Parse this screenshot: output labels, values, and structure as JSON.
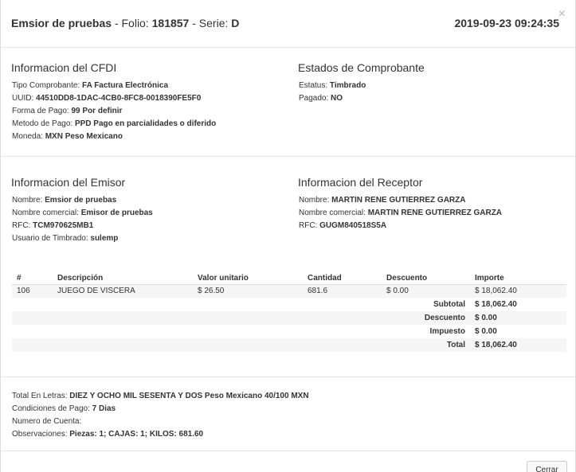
{
  "header": {
    "emisor": "Emsior de pruebas",
    "folio_label": "Folio:",
    "folio": "181857",
    "serie_label": "Serie:",
    "serie": "D",
    "datetime": "2019-09-23 09:24:35",
    "close_glyph": "×"
  },
  "cfdi": {
    "title": "Informacion del CFDI",
    "fields": [
      {
        "label": "Tipo Comprobante:",
        "value": "FA Factura Electrónica"
      },
      {
        "label": "UUID:",
        "value": "44510DD8-1DAC-4CB0-8FC8-0018390FE5F0"
      },
      {
        "label": "Forma de Pago:",
        "value": "99 Por definir"
      },
      {
        "label": "Metodo de Pago:",
        "value": "PPD Pago en parcialidades o diferido"
      },
      {
        "label": "Moneda:",
        "value": "MXN Peso Mexicano"
      }
    ]
  },
  "estados": {
    "title": "Estados de Comprobante",
    "fields": [
      {
        "label": "Estatus:",
        "value": "Timbrado"
      },
      {
        "label": "Pagado:",
        "value": "NO"
      }
    ]
  },
  "emisor": {
    "title": "Informacion del Emisor",
    "fields": [
      {
        "label": "Nombre:",
        "value": "Emsior de pruebas"
      },
      {
        "label": "Nombre comercial:",
        "value": "Emisor de pruebas"
      },
      {
        "label": "RFC:",
        "value": "TCM970625MB1"
      },
      {
        "label": "Usuario de Timbrado:",
        "value": "sulemp"
      }
    ]
  },
  "receptor": {
    "title": "Informacion del Receptor",
    "fields": [
      {
        "label": "Nombre:",
        "value": "MARTIN RENE GUTIERREZ GARZA"
      },
      {
        "label": "Nombre comercial:",
        "value": "MARTIN RENE GUTIERREZ GARZA"
      },
      {
        "label": "RFC:",
        "value": "GUGM840518S5A"
      }
    ]
  },
  "items": {
    "headers": [
      "#",
      "Descripción",
      "Valor unitario",
      "Cantidad",
      "Descuento",
      "Importe"
    ],
    "rows": [
      [
        "106",
        "JUEGO DE VISCERA",
        "$ 26.50",
        "681.6",
        "$ 0.00",
        "$ 18,062.40"
      ]
    ],
    "totals": [
      {
        "label": "Subtotal",
        "value": "$ 18,062.40"
      },
      {
        "label": "Descuento",
        "value": "$ 0.00"
      },
      {
        "label": "Impuesto",
        "value": "$ 0.00"
      },
      {
        "label": "Total",
        "value": "$ 18,062.40"
      }
    ]
  },
  "bottom": {
    "fields": [
      {
        "label": "Total En Letras:",
        "value": "DIEZ Y OCHO MIL SESENTA Y DOS Peso Mexicano 40/100 MXN"
      },
      {
        "label": "Condiciones de Pago:",
        "value": "7 Dias"
      },
      {
        "label": "Numero de Cuenta:",
        "value": ""
      },
      {
        "label": "Observaciones:",
        "value": "Piezas: 1; CAJAS: 1; KILOS: 681.60"
      }
    ]
  },
  "footer": {
    "close_label": "Cerrar"
  }
}
